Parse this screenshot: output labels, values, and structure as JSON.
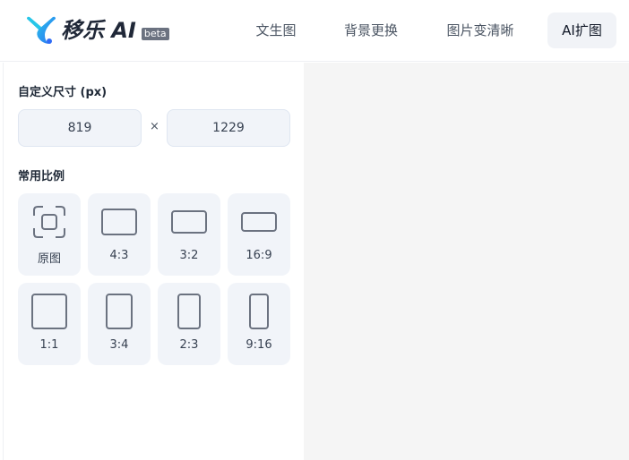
{
  "brand": {
    "name": "移乐 AI",
    "badge": "beta"
  },
  "nav": {
    "items": [
      {
        "label": "文生图",
        "active": false
      },
      {
        "label": "背景更换",
        "active": false
      },
      {
        "label": "图片变清晰",
        "active": false
      },
      {
        "label": "AI扩图",
        "active": true
      }
    ]
  },
  "custom_size": {
    "title": "自定义尺寸 (px)",
    "width": "819",
    "height": "1229",
    "separator": "×"
  },
  "ratios": {
    "title": "常用比例",
    "items": [
      {
        "label": "原图",
        "icon": "original-frame-icon"
      },
      {
        "label": "4:3",
        "icon": "ratio-4-3-icon"
      },
      {
        "label": "3:2",
        "icon": "ratio-3-2-icon"
      },
      {
        "label": "16:9",
        "icon": "ratio-16-9-icon"
      },
      {
        "label": "1:1",
        "icon": "ratio-1-1-icon"
      },
      {
        "label": "3:4",
        "icon": "ratio-3-4-icon"
      },
      {
        "label": "2:3",
        "icon": "ratio-2-3-icon"
      },
      {
        "label": "9:16",
        "icon": "ratio-9-16-icon"
      }
    ]
  },
  "colors": {
    "accent_blue": "#2f7cf6",
    "accent_cyan": "#27c6e8",
    "card_bg": "#f1f4f9",
    "canvas_bg": "#f5f5f5"
  }
}
